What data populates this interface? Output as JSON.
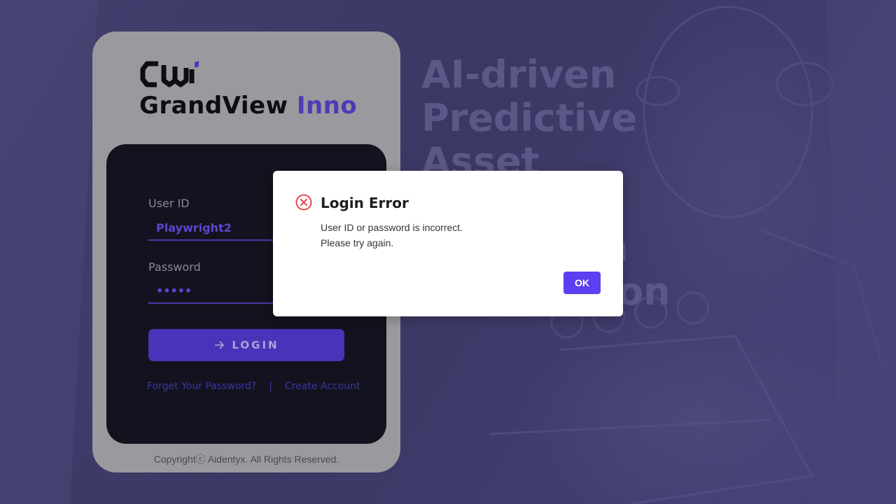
{
  "brand": {
    "name_main": "GrandView",
    "name_accent": "Inno"
  },
  "hero": {
    "lines": [
      "AI-driven",
      "Predictive",
      "Asset",
      "Anomaly Detection",
      "Automation"
    ]
  },
  "form": {
    "user_id_label": "User ID",
    "user_id_value": "Playwright2",
    "password_label": "Password",
    "password_value": "•••••",
    "login_label": "LOGIN",
    "forgot_link": "Forget Your Password?",
    "separator": "|",
    "create_link": "Create Account"
  },
  "footer": {
    "copyright": "Copyrightⓒ Aidentyx. All Rights Reserved."
  },
  "dialog": {
    "title": "Login Error",
    "message_line1": "User ID or password is incorrect.",
    "message_line2": "Please try again.",
    "ok_label": "OK",
    "icon": "error-circle-icon"
  },
  "colors": {
    "accent": "#5a40f0",
    "brand_purple": "#4e3bb8",
    "error": "#e5484d",
    "panel": "#13131f"
  }
}
